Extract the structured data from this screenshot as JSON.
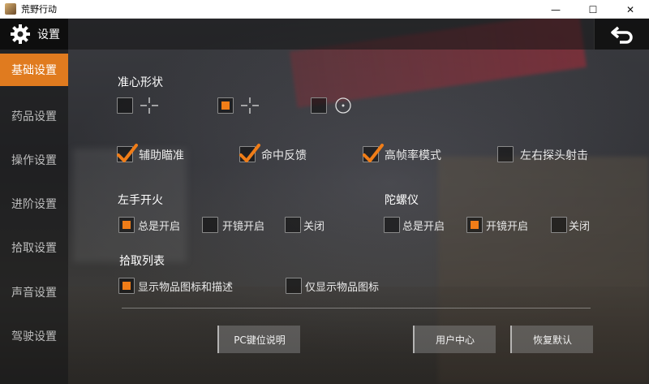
{
  "window": {
    "title": "荒野行动",
    "controls": {
      "minimize": "—",
      "maximize": "☐",
      "close": "✕"
    }
  },
  "header": {
    "title": "设置"
  },
  "sidebar": {
    "items": [
      {
        "label": "基础设置",
        "active": true
      },
      {
        "label": "药品设置",
        "active": false
      },
      {
        "label": "操作设置",
        "active": false
      },
      {
        "label": "进阶设置",
        "active": false
      },
      {
        "label": "拾取设置",
        "active": false
      },
      {
        "label": "声音设置",
        "active": false
      },
      {
        "label": "驾驶设置",
        "active": false
      }
    ]
  },
  "crosshair": {
    "title": "准心形状",
    "options": [
      {
        "icon": "crosshair-gap-icon",
        "checked": false
      },
      {
        "icon": "crosshair-gap-icon",
        "checked": true
      },
      {
        "icon": "crosshair-dot-circle-icon",
        "checked": false
      }
    ]
  },
  "toggles": [
    {
      "label": "辅助瞄准",
      "checked": true
    },
    {
      "label": "命中反馈",
      "checked": true
    },
    {
      "label": "高帧率模式",
      "checked": true
    },
    {
      "label": "左右探头射击",
      "checked": false
    }
  ],
  "left_fire": {
    "title": "左手开火",
    "options": [
      {
        "label": "总是开启",
        "checked": true
      },
      {
        "label": "开镜开启",
        "checked": false
      },
      {
        "label": "关闭",
        "checked": false
      }
    ]
  },
  "gyro": {
    "title": "陀螺仪",
    "options": [
      {
        "label": "总是开启",
        "checked": false
      },
      {
        "label": "开镜开启",
        "checked": true
      },
      {
        "label": "关闭",
        "checked": false
      }
    ]
  },
  "pickup_list": {
    "title": "拾取列表",
    "options": [
      {
        "label": "显示物品图标和描述",
        "checked": true
      },
      {
        "label": "仅显示物品图标",
        "checked": false
      }
    ]
  },
  "buttons": {
    "keys": "PC键位说明",
    "user_center": "用户中心",
    "reset": "恢复默认"
  },
  "colors": {
    "accent": "#e07b1f",
    "checkbox_fill": "#f07d18"
  }
}
